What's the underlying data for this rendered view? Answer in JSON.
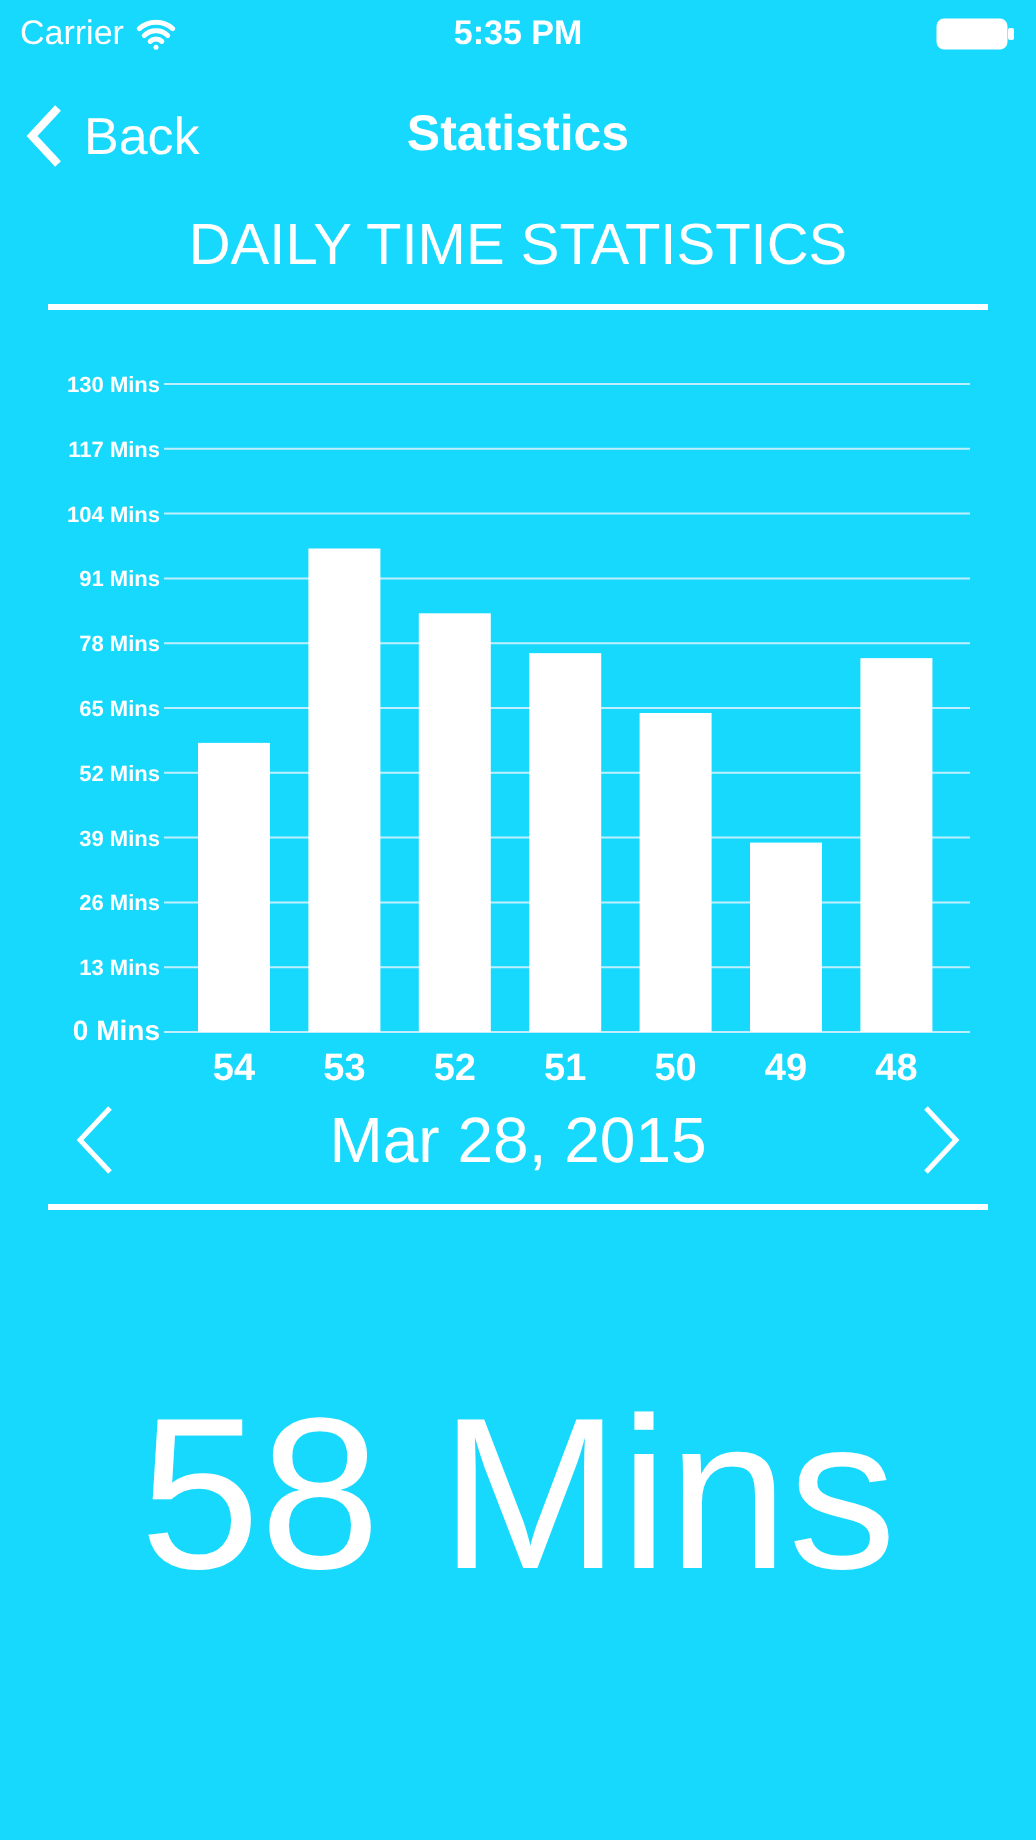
{
  "status_bar": {
    "carrier": "Carrier",
    "time": "5:35 PM"
  },
  "nav_bar": {
    "back": "Back",
    "title": "Statistics"
  },
  "heading": "DAILY TIME STATISTICS",
  "chart_data": {
    "type": "bar",
    "categories": [
      "54",
      "53",
      "52",
      "51",
      "50",
      "49",
      "48"
    ],
    "grid": true,
    "series": [
      {
        "color": "#ffffff",
        "values": [
          58,
          97,
          84,
          76,
          64,
          38,
          75
        ]
      }
    ],
    "ylim": [
      0,
      130
    ],
    "yticks": [
      {
        "value": 0,
        "label": "0 Mins"
      },
      {
        "value": 13,
        "label": "13 Mins"
      },
      {
        "value": 26,
        "label": "26 Mins"
      },
      {
        "value": 39,
        "label": "39 Mins"
      },
      {
        "value": 52,
        "label": "52 Mins"
      },
      {
        "value": 65,
        "label": "65 Mins"
      },
      {
        "value": 78,
        "label": "78 Mins"
      },
      {
        "value": 91,
        "label": "91 Mins"
      },
      {
        "value": 104,
        "label": "104 Mins"
      },
      {
        "value": 117,
        "label": "117 Mins"
      },
      {
        "value": 130,
        "label": "130 Mins"
      }
    ]
  },
  "date_nav": {
    "date": "Mar 28, 2015"
  },
  "total": "58 Mins"
}
